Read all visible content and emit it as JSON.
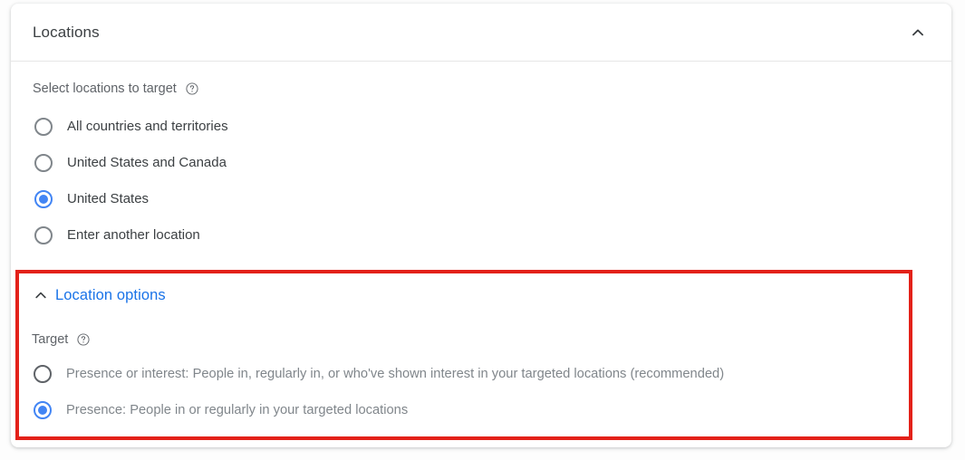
{
  "card": {
    "header": {
      "title": "Locations",
      "collapse_icon": "chevron-up-icon"
    },
    "select_locations": {
      "label": "Select locations to target",
      "help_icon": "help-circle-icon",
      "options": [
        {
          "label": "All countries and territories",
          "selected": false
        },
        {
          "label": "United States and Canada",
          "selected": false
        },
        {
          "label": "United States",
          "selected": true
        },
        {
          "label": "Enter another location",
          "selected": false
        }
      ]
    },
    "location_options": {
      "toggle_label": "Location options",
      "toggle_icon": "chevron-up-icon",
      "expanded": true,
      "highlight_color": "#e32119",
      "target": {
        "label": "Target",
        "help_icon": "help-circle-icon",
        "options": [
          {
            "label": "Presence or interest: People in, regularly in, or who've shown interest in your targeted locations (recommended)",
            "selected": false
          },
          {
            "label": "Presence: People in or regularly in your targeted locations",
            "selected": true
          }
        ]
      }
    }
  },
  "colors": {
    "accent_blue": "#4285f4",
    "link_blue": "#1a73e8",
    "text_primary": "#3c4043",
    "text_secondary": "#5f6368",
    "text_muted": "#80868b",
    "highlight_red": "#e32119"
  }
}
